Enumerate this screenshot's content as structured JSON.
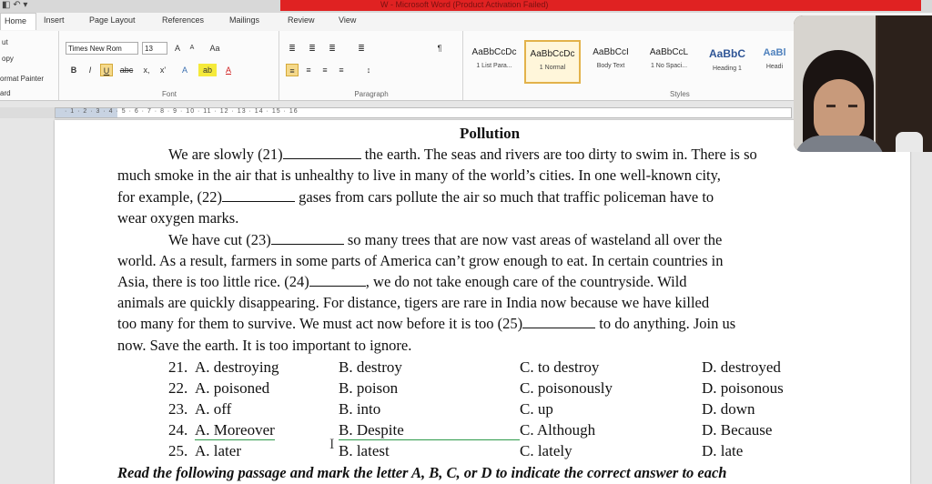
{
  "window": {
    "title": "W - Microsoft Word (Product Activation Failed)"
  },
  "tabs": [
    "Home",
    "Insert",
    "Page Layout",
    "References",
    "Mailings",
    "Review",
    "View"
  ],
  "clipboard": {
    "labels": [
      "ut",
      "opy",
      "ormat Painter",
      "ard"
    ]
  },
  "font": {
    "name": "Times New Rom",
    "size": "13",
    "group_label": "Font",
    "glyphs": [
      "A",
      "A",
      "Aa",
      "B",
      "I",
      "U",
      "abc",
      "x,",
      "x'",
      "A",
      "ab",
      "A"
    ]
  },
  "paragraph": {
    "group_label": "Paragraph",
    "glyphs": [
      "≣",
      "≣",
      "≣",
      "≣",
      "¶",
      "≡",
      "≡",
      "≡",
      "≡",
      "↕"
    ]
  },
  "styles": {
    "group_label": "Styles",
    "items": [
      {
        "sample": "AaBbCcDc",
        "name": "1 List Para..."
      },
      {
        "sample": "AaBbCcDc",
        "name": "1 Normal"
      },
      {
        "sample": "AaBbCcI",
        "name": "Body Text"
      },
      {
        "sample": "AaBbCcL",
        "name": "1 No Spaci..."
      },
      {
        "sample": "AaBbC",
        "name": "Heading 1"
      },
      {
        "sample": "AaBl",
        "name": "Headi"
      }
    ]
  },
  "ruler": {
    "numbers": "· 1 · 2 · 3 · 4 · 5 · 6 · 7 · 8 · 9 · 10 · 11 · 12 · 13 · 14 · 15 · 16"
  },
  "document": {
    "title": "Pollution",
    "lines": [
      [
        "We are slowly (21)",
        "",
        "the earth. The seas and rivers are too dirty to swim in. There is so"
      ],
      [
        "much smoke in the air that is unhealthy to live in many of the world’s cities. In one well-known city,"
      ],
      [
        "for example, (22)",
        "",
        "gases from cars pollute the air so much that traffic policeman have to"
      ],
      [
        "wear oxygen marks."
      ],
      [
        "We have cut (23)",
        "",
        "so many trees that are now vast areas of wasteland all over the"
      ],
      [
        "world. As a result, farmers in some parts of America can’t grow enough to eat. In certain countries in"
      ],
      [
        "Asia, there is too little rice. (24)",
        "",
        ", we do not take enough care of the countryside. Wild"
      ],
      [
        "animals are quickly disappearing. For distance, tigers are rare in India now because we have killed"
      ],
      [
        "too many for them to survive. We must act now before it is too (25)",
        "",
        "to do anything. Join us"
      ],
      [
        "now. Save the earth. It is too important to ignore."
      ]
    ],
    "questions": [
      {
        "num": "21.",
        "a": "A. destroying",
        "b": "B. destroy",
        "c": "C. to destroy",
        "d": "D. destroyed"
      },
      {
        "num": "22.",
        "a": "A. poisoned",
        "b": "B. poison",
        "c": "C. poisonously",
        "d": "D. poisonous"
      },
      {
        "num": "23.",
        "a": "A. off",
        "b": "B. into",
        "c": "C. up",
        "d": "D. down"
      },
      {
        "num": "24.",
        "a": "A. Moreover",
        "b": "B. Despite",
        "c": "C. Although",
        "d": "D. Because"
      },
      {
        "num": "25.",
        "a": "A. later",
        "b": "B. latest",
        "c": "C. lately",
        "d": "D. late"
      }
    ],
    "footer_line": "Read the following passage and mark the letter A, B, C, or D to indicate the correct answer to each"
  },
  "colors": {
    "title_bar_red": "#e02222",
    "style_highlight": "#e3b24a",
    "spell_underline": "#2e9b4a"
  }
}
